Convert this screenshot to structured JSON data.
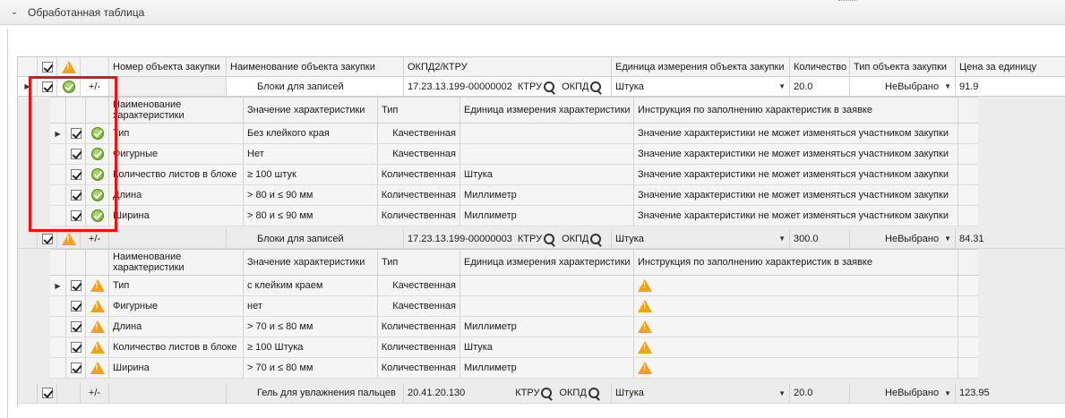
{
  "panel": {
    "title": "Обработанная таблица"
  },
  "columns": {
    "number": "Номер объекта закупки",
    "name": "Наименование объекта закупки",
    "okpd": "ОКПД2/КТРУ",
    "unit": "Единица измерения объекта закупки",
    "qty": "Количество",
    "type": "Тип объекта закупки",
    "price": "Цена за единицу"
  },
  "sub_columns": {
    "name": "Наименование характеристики",
    "value": "Значение характеристики",
    "type": "Тип",
    "unit": "Единица измерения характеристики",
    "instr": "Инструкция по заполнению характеристик в заявке"
  },
  "labels": {
    "plusminus": "+/-",
    "ktru": "КТРУ",
    "okpd": "ОКПД"
  },
  "items": [
    {
      "name": "Блоки для записей",
      "code": "17.23.13.199-00000002",
      "unit": "Штука",
      "qty": "20.0",
      "type": "НеВыбрано",
      "price": "91.9",
      "status": "ok",
      "chars": [
        {
          "name": "Тип",
          "value": "Без клейкого края",
          "type": "Качественная",
          "unit": "",
          "instr": "Значение характеристики не может изменяться участником закупки"
        },
        {
          "name": "Фигурные",
          "value": "Нет",
          "type": "Качественная",
          "unit": "",
          "instr": "Значение характеристики не может изменяться участником закупки"
        },
        {
          "name": "Количество листов в блоке",
          "value": "≥ 100 штук",
          "type": "Количественная",
          "unit": "Штука",
          "instr": "Значение характеристики не может изменяться участником закупки"
        },
        {
          "name": "Длина",
          "value": "> 80 и ≤ 90 мм",
          "type": "Количественная",
          "unit": "Миллиметр",
          "instr": "Значение характеристики не может изменяться участником закупки"
        },
        {
          "name": "Ширина",
          "value": "> 80 и ≤ 90 мм",
          "type": "Количественная",
          "unit": "Миллиметр",
          "instr": "Значение характеристики не может изменяться участником закупки"
        }
      ]
    },
    {
      "name": "Блоки для записей",
      "code": "17.23.13.199-00000003",
      "unit": "Штука",
      "qty": "300.0",
      "type": "НеВыбрано",
      "price": "84.31",
      "status": "warn",
      "chars": [
        {
          "name": "Тип",
          "value": "с клейким краем",
          "type": "Качественная",
          "unit": "",
          "instr": ""
        },
        {
          "name": "Фигурные",
          "value": "нет",
          "type": "Качественная",
          "unit": "",
          "instr": ""
        },
        {
          "name": "Длина",
          "value": "> 70 и ≤ 80 мм",
          "type": "Количественная",
          "unit": "Миллиметр",
          "instr": ""
        },
        {
          "name": "Количество листов в блоке",
          "value": "≥ 100 Штука",
          "type": "Количественная",
          "unit": "Штука",
          "instr": ""
        },
        {
          "name": "Ширина",
          "value": "> 70 и ≤ 80 мм",
          "type": "Количественная",
          "unit": "Миллиметр",
          "instr": ""
        }
      ]
    },
    {
      "name": "Гель для увлажнения пальцев",
      "code": "20.41.20.130",
      "unit": "Штука",
      "qty": "20.0",
      "type": "НеВыбрано",
      "price": "123.95",
      "status": "none",
      "chars": []
    }
  ],
  "colors": {
    "highlight": "#ee1111",
    "ok": "#5ca21f",
    "warn": "#f0a21a"
  }
}
